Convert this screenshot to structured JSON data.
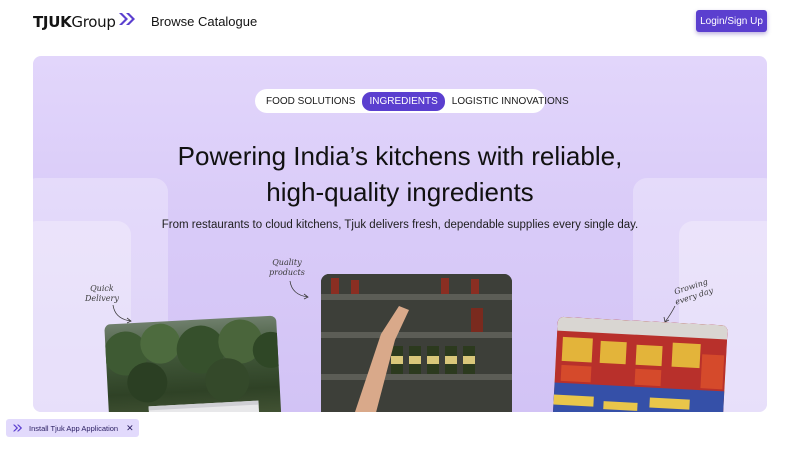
{
  "header": {
    "logo_bold": "TJUK",
    "logo_light": "Group",
    "browse_label": "Browse Catalogue",
    "login_label": "Login/Sign Up"
  },
  "hero": {
    "tabs": [
      {
        "label": "FOOD SOLUTIONS",
        "active": false
      },
      {
        "label": "INGREDIENTS",
        "active": true
      },
      {
        "label": "LOGISTIC INNOVATIONS",
        "active": false
      }
    ],
    "headline_line1": "Powering India’s kitchens with reliable,",
    "headline_line2": "high-quality ingredients",
    "subline": "From restaurants to cloud kitchens, Tjuk delivers fresh, dependable supplies every single day.",
    "annotations": {
      "quick_delivery_1": "Quick",
      "quick_delivery_2": "Delivery",
      "quality_products_1": "Quality",
      "quality_products_2": "products",
      "growing_1": "Growing",
      "growing_2": "every day"
    }
  },
  "install_bar": {
    "label": "Install Tjuk App Application",
    "close": "✕"
  },
  "colors": {
    "brand": "#5b3fcf",
    "hero_bg": "#dccff9"
  },
  "icons": [
    "chevrons-right-icon",
    "close-icon"
  ]
}
